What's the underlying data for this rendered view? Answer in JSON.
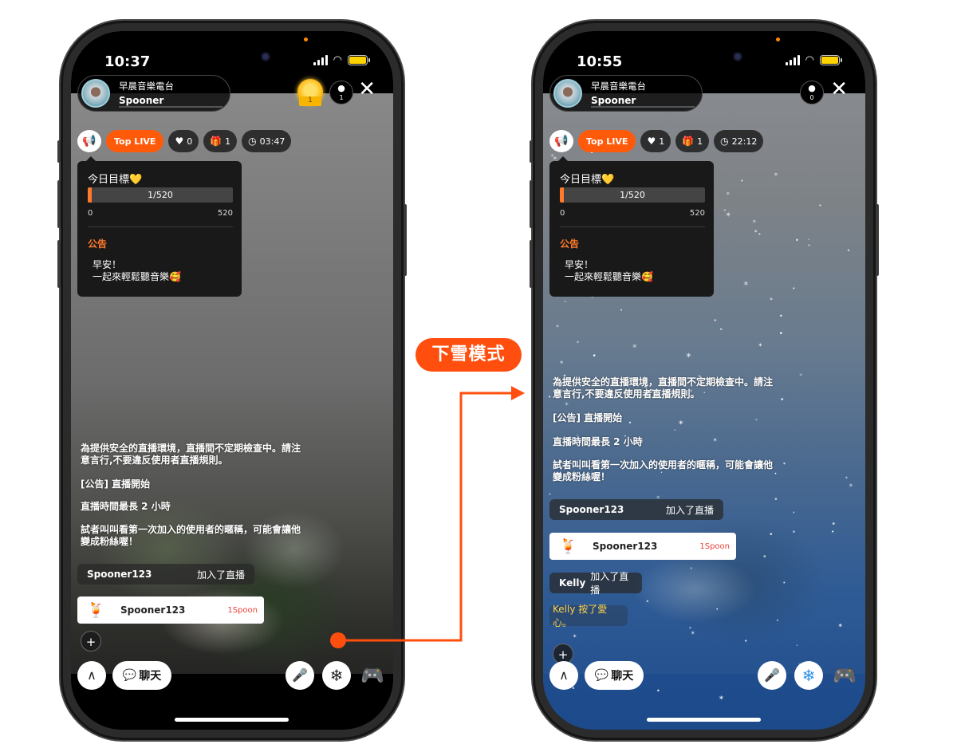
{
  "annotation": {
    "tag": "下雪模式"
  },
  "left": {
    "time": "10:37",
    "host": {
      "title": "早晨音樂電台",
      "name": "Spooner"
    },
    "rank_number": "1",
    "viewers": "1",
    "chips": {
      "top": "Top LIVE",
      "likes": "0",
      "gifts": "1",
      "duration": "03:47"
    },
    "popup": {
      "goal": "今日目標💛",
      "progress_text": "1/520",
      "progress_fraction": 0.02,
      "min": "0",
      "max": "520",
      "ann_title": "公告",
      "ann_line1": "早安！",
      "ann_line2": "一起來輕鬆聽音樂🥰"
    },
    "sys": {
      "line1": "為提供安全的直播環境，直播間不定期檢查中。請注",
      "line2": "意言行,不要違反使用者直播規則。",
      "notice": "[公告] 直播開始",
      "duration": "直播時間最長  2 小時",
      "tip1": "試者叫叫看第一次加入的使用者的暱稱，可能會讓他",
      "tip2": "變成粉絲喔！"
    },
    "join": {
      "name": "Spooner123",
      "action": "加入了直播"
    },
    "gift": {
      "name": "Spooner123",
      "amount": "1Spoon"
    },
    "chat_label": "聊天"
  },
  "right": {
    "time": "10:55",
    "host": {
      "title": "早晨音樂電台",
      "name": "Spooner"
    },
    "viewers": "0",
    "chips": {
      "top": "Top LIVE",
      "likes": "1",
      "gifts": "1",
      "duration": "22:12"
    },
    "popup": {
      "goal": "今日目標💛",
      "progress_text": "1/520",
      "progress_fraction": 0.02,
      "min": "0",
      "max": "520",
      "ann_title": "公告",
      "ann_line1": "早安！",
      "ann_line2": "一起來輕鬆聽音樂🥰"
    },
    "sys": {
      "line1": "為提供安全的直播環境，直播間不定期檢查中。請注",
      "line2": "意言行,不要違反使用者直播規則。",
      "notice": "[公告] 直播開始",
      "duration": "直播時間最長  2 小時",
      "tip1": "試者叫叫看第一次加入的使用者的暱稱，可能會讓他",
      "tip2": "變成粉絲喔！"
    },
    "join": {
      "name": "Spooner123",
      "action": "加入了直播"
    },
    "gift": {
      "name": "Spooner123",
      "amount": "1Spoon"
    },
    "join2": {
      "name": "Kelly",
      "action": "加入了直播"
    },
    "like_msg": "Kelly 按了愛心。",
    "chat_label": "聊天"
  },
  "colors": {
    "accent": "#ff4e0e",
    "progress": "#ff7a2a",
    "gift_amount": "#e8423c",
    "like_msg": "#ffd24a"
  }
}
